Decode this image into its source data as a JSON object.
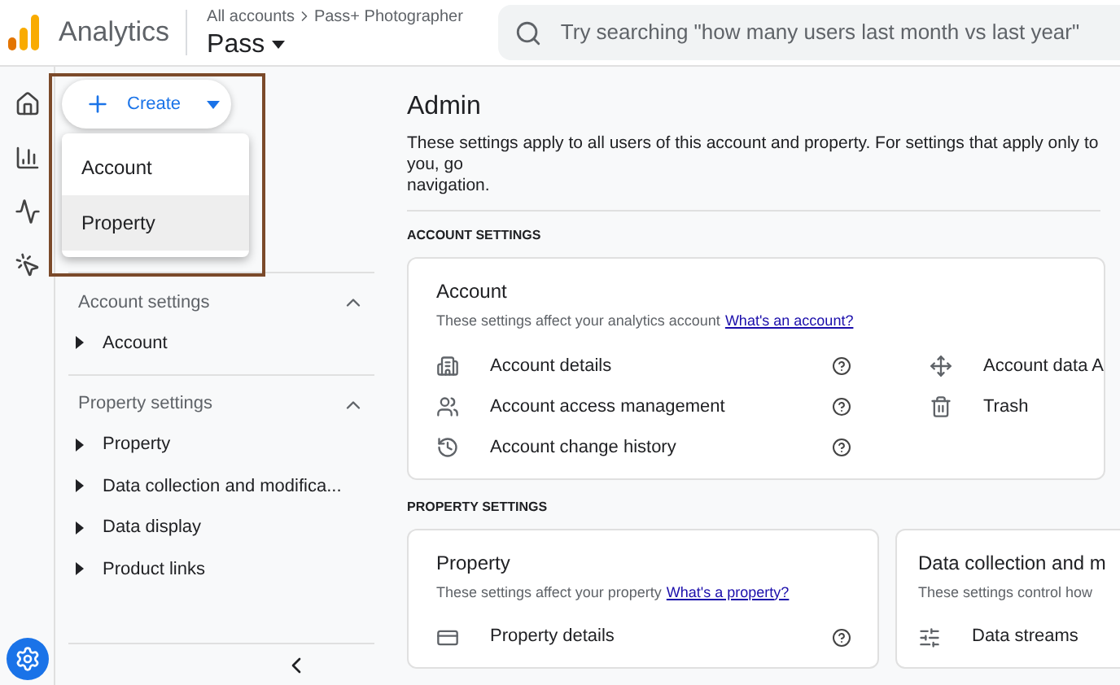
{
  "header": {
    "app_name": "Analytics",
    "breadcrumb": [
      "All accounts",
      "Pass+ Photographer"
    ],
    "property": "Pass",
    "search": {
      "placeholder": "Try searching \"how many users last month vs last year\""
    }
  },
  "create": {
    "label": "Create",
    "menu": [
      {
        "label": "Account",
        "selected": false
      },
      {
        "label": "Property",
        "selected": true
      }
    ]
  },
  "sidebar": {
    "sections": [
      {
        "title": "Account settings",
        "expanded": true,
        "items": [
          "Account"
        ]
      },
      {
        "title": "Property settings",
        "expanded": true,
        "items": [
          "Property",
          "Data collection and modifica...",
          "Data display",
          "Product links"
        ]
      }
    ]
  },
  "main": {
    "title": "Admin",
    "description": "These settings apply to all users of this account and property. For settings that apply only to you, go",
    "description_2": "navigation.",
    "sections": [
      {
        "heading": "ACCOUNT SETTINGS",
        "cards": [
          {
            "title": "Account",
            "description": "These settings affect your analytics account",
            "link": "What's an account?",
            "rows": [
              {
                "label": "Account details",
                "help": true
              },
              {
                "label": "Account access management",
                "help": true
              },
              {
                "label": "Account change history",
                "help": true
              }
            ],
            "side_rows": [
              {
                "label": "Account data A"
              },
              {
                "label": "Trash"
              }
            ]
          }
        ]
      },
      {
        "heading": "PROPERTY SETTINGS",
        "cards": [
          {
            "title": "Property",
            "description": "These settings affect your property",
            "link": "What's a property?",
            "rows": [
              {
                "label": "Property details",
                "help": true
              }
            ]
          },
          {
            "title": "Data collection and m",
            "description": "These settings control how",
            "rows": [
              {
                "label": "Data streams",
                "help": false
              }
            ]
          }
        ]
      }
    ]
  }
}
